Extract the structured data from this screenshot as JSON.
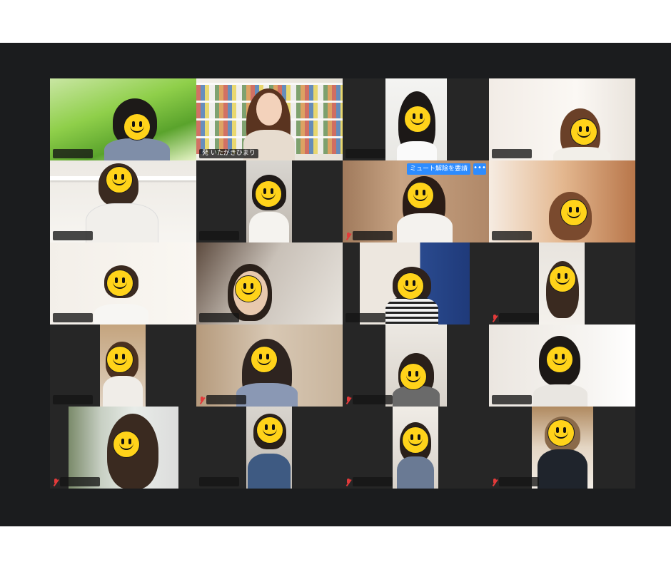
{
  "participants": [
    {
      "name": "",
      "muted": false,
      "active": false
    },
    {
      "name": "発 いたがきひまり",
      "muted": false,
      "active": true
    },
    {
      "name": "",
      "muted": false,
      "active": false
    },
    {
      "name": "",
      "muted": false,
      "active": false
    },
    {
      "name": "",
      "muted": false,
      "active": false
    },
    {
      "name": "",
      "muted": false,
      "active": false
    },
    {
      "name": "",
      "muted": true,
      "active": false
    },
    {
      "name": "",
      "muted": false,
      "active": false
    },
    {
      "name": "",
      "muted": false,
      "active": false
    },
    {
      "name": "",
      "muted": false,
      "active": false
    },
    {
      "name": "",
      "muted": false,
      "active": false
    },
    {
      "name": "",
      "muted": true,
      "active": false
    },
    {
      "name": "",
      "muted": false,
      "active": false
    },
    {
      "name": "",
      "muted": true,
      "active": false
    },
    {
      "name": "",
      "muted": true,
      "active": false
    },
    {
      "name": "",
      "muted": false,
      "active": false
    },
    {
      "name": "",
      "muted": true,
      "active": false
    },
    {
      "name": "",
      "muted": false,
      "active": false
    },
    {
      "name": "",
      "muted": true,
      "active": false
    },
    {
      "name": "",
      "muted": true,
      "active": false
    }
  ],
  "controls": {
    "unmute_request_label": "ミュート解除を要請",
    "more_label": "•••"
  },
  "colors": {
    "active_speaker_border": "#3cc13b",
    "button_blue": "#2d8cff",
    "muted_red": "#e23a3a",
    "window_bg": "#1b1c1e"
  }
}
